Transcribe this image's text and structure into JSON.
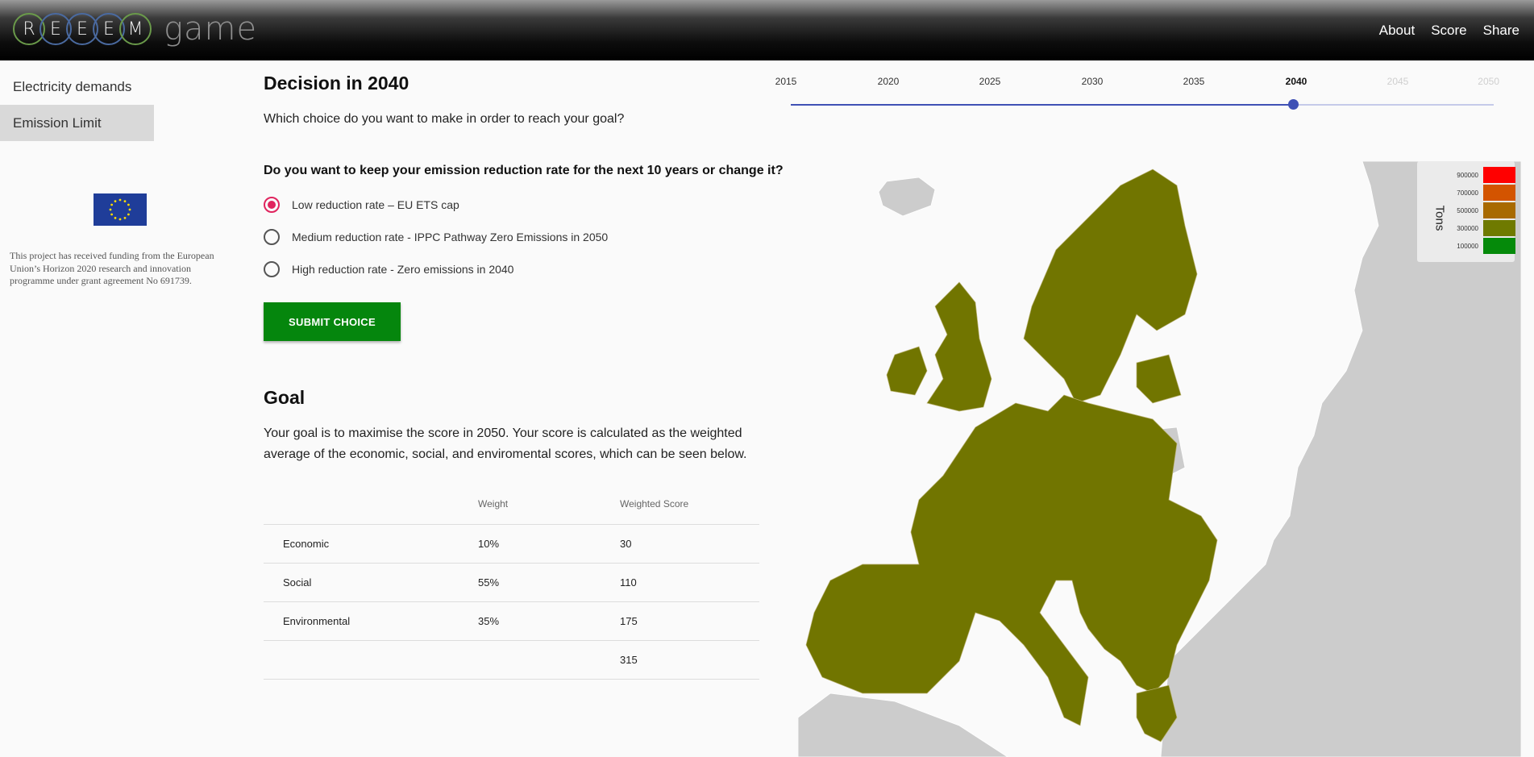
{
  "header": {
    "logo_letters": [
      "R",
      "E",
      "E",
      "E",
      "M"
    ],
    "logo_word": "game",
    "nav": [
      "About",
      "Score",
      "Share"
    ]
  },
  "sidebar": {
    "items": [
      {
        "label": "Electricity demands",
        "active": false
      },
      {
        "label": "Emission Limit",
        "active": true
      }
    ],
    "funding_text": "This project has received funding from the European Union’s Horizon 2020 research and innovation programme under grant agreement No 691739."
  },
  "decision": {
    "title": "Decision in 2040",
    "subtitle": "Which choice do you want to make in order to reach your goal?",
    "question": "Do you want to keep your emission reduction rate for the next 10 years or change it?",
    "options": [
      {
        "label": "Low reduction rate – EU ETS cap",
        "selected": true
      },
      {
        "label": "Medium reduction rate - IPPC Pathway Zero Emissions in 2050",
        "selected": false
      },
      {
        "label": "High reduction rate - Zero emissions in 2040",
        "selected": false
      }
    ],
    "submit_label": "SUBMIT CHOICE"
  },
  "goal": {
    "title": "Goal",
    "text": "Your goal is to maximise the score in 2050. Your score is calculated as the weighted average of the economic, social, and enviromental scores, which can be seen below.",
    "columns": [
      "",
      "Weight",
      "Weighted Score"
    ],
    "rows": [
      [
        "Economic",
        "10%",
        "30"
      ],
      [
        "Social",
        "55%",
        "110"
      ],
      [
        "Environmental",
        "35%",
        "175"
      ],
      [
        "",
        "",
        "315"
      ]
    ]
  },
  "timeline": {
    "years": [
      "2015",
      "2020",
      "2025",
      "2030",
      "2035",
      "2040",
      "2045",
      "2050"
    ],
    "current": "2040"
  },
  "map": {
    "legend_title": "Tons",
    "legend": [
      {
        "label": "900000",
        "color": "#ff0000"
      },
      {
        "label": "700000",
        "color": "#d35400"
      },
      {
        "label": "500000",
        "color": "#a86a00"
      },
      {
        "label": "300000",
        "color": "#6f7a00"
      },
      {
        "label": "100000",
        "color": "#058a0a"
      }
    ],
    "fill_color": "#717500",
    "other_color": "#cccccc"
  }
}
